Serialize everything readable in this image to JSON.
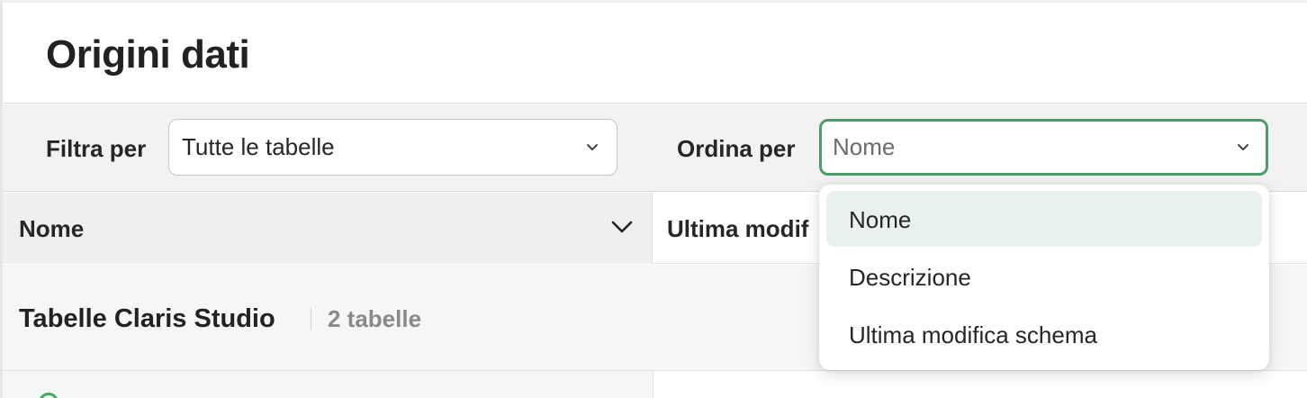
{
  "page": {
    "title": "Origini dati"
  },
  "toolbar": {
    "filter_label": "Filtra per",
    "filter_value": "Tutte le tabelle",
    "sort_label": "Ordina per",
    "sort_value": "Nome"
  },
  "table": {
    "columns": [
      {
        "label": "Nome"
      },
      {
        "label": "Ultima modif"
      }
    ]
  },
  "groups": [
    {
      "title": "Tabelle Claris Studio",
      "count": "2 tabelle"
    }
  ],
  "sort_dropdown": {
    "options": [
      {
        "label": "Nome",
        "selected": true
      },
      {
        "label": "Descrizione",
        "selected": false
      },
      {
        "label": "Ultima modifica schema",
        "selected": false
      }
    ]
  },
  "colors": {
    "focus_border": "#4f9a6a",
    "selected_option_bg": "#e8f1eb",
    "status_green": "#3fae5a"
  },
  "icons": {
    "select_chevron": "chevron-down-icon",
    "sort_column_chevron": "chevron-down-icon",
    "status": "status-circle-icon"
  }
}
